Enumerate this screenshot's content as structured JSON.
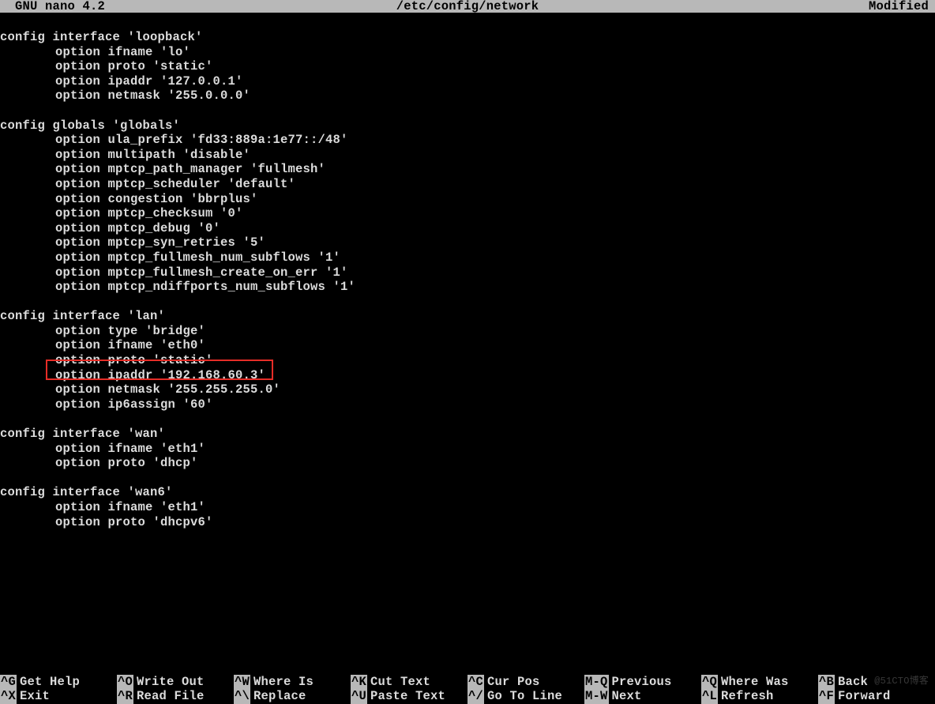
{
  "title_bar": {
    "app": "  GNU nano 4.2",
    "file": "/etc/config/network",
    "status": "Modified"
  },
  "lines": [
    {
      "c": "c0",
      "t": "config interface 'loopback'"
    },
    {
      "c": "c8",
      "t": "option ifname 'lo'"
    },
    {
      "c": "c8",
      "t": "option proto 'static'"
    },
    {
      "c": "c8",
      "t": "option ipaddr '127.0.0.1'"
    },
    {
      "c": "c8",
      "t": "option netmask '255.0.0.0'"
    },
    {
      "c": "c0",
      "t": ""
    },
    {
      "c": "c0",
      "t": "config globals 'globals'"
    },
    {
      "c": "c8",
      "t": "option ula_prefix 'fd33:889a:1e77::/48'"
    },
    {
      "c": "c8",
      "t": "option multipath 'disable'"
    },
    {
      "c": "c8",
      "t": "option mptcp_path_manager 'fullmesh'"
    },
    {
      "c": "c8",
      "t": "option mptcp_scheduler 'default'"
    },
    {
      "c": "c8",
      "t": "option congestion 'bbrplus'"
    },
    {
      "c": "c8",
      "t": "option mptcp_checksum '0'"
    },
    {
      "c": "c8",
      "t": "option mptcp_debug '0'"
    },
    {
      "c": "c8",
      "t": "option mptcp_syn_retries '5'"
    },
    {
      "c": "c8",
      "t": "option mptcp_fullmesh_num_subflows '1'"
    },
    {
      "c": "c8",
      "t": "option mptcp_fullmesh_create_on_err '1'"
    },
    {
      "c": "c8",
      "t": "option mptcp_ndiffports_num_subflows '1'"
    },
    {
      "c": "c0",
      "t": ""
    },
    {
      "c": "c0",
      "t": "config interface 'lan'"
    },
    {
      "c": "c8",
      "t": "option type 'bridge'"
    },
    {
      "c": "c8",
      "t": "option ifname 'eth0'"
    },
    {
      "c": "c8",
      "t": "option proto 'static'"
    },
    {
      "c": "c8",
      "t": "option ipaddr '192.168.60.3'"
    },
    {
      "c": "c8",
      "t": "option netmask '255.255.255.0'"
    },
    {
      "c": "c8",
      "t": "option ip6assign '60'"
    },
    {
      "c": "c0",
      "t": ""
    },
    {
      "c": "c0",
      "t": "config interface 'wan'"
    },
    {
      "c": "c8",
      "t": "option ifname 'eth1'"
    },
    {
      "c": "c8",
      "t": "option proto 'dhcp'"
    },
    {
      "c": "c0",
      "t": ""
    },
    {
      "c": "c0",
      "t": "config interface 'wan6'"
    },
    {
      "c": "c8",
      "t": "option ifname 'eth1'"
    },
    {
      "c": "c8",
      "t": "option proto 'dhcpv6'"
    }
  ],
  "shortcuts": {
    "row0": [
      {
        "key": "^G",
        "label": "Get Help"
      },
      {
        "key": "^O",
        "label": "Write Out"
      },
      {
        "key": "^W",
        "label": "Where Is"
      },
      {
        "key": "^K",
        "label": "Cut Text"
      },
      {
        "key": "^C",
        "label": "Cur Pos"
      },
      {
        "key": "M-Q",
        "label": "Previous"
      },
      {
        "key": "^Q",
        "label": "Where Was"
      },
      {
        "key": "^B",
        "label": "Back"
      }
    ],
    "row1": [
      {
        "key": "^X",
        "label": "Exit"
      },
      {
        "key": "^R",
        "label": "Read File"
      },
      {
        "key": "^\\",
        "label": "Replace"
      },
      {
        "key": "^U",
        "label": "Paste Text"
      },
      {
        "key": "^/",
        "label": "Go To Line"
      },
      {
        "key": "M-W",
        "label": "Next"
      },
      {
        "key": "^L",
        "label": "Refresh"
      },
      {
        "key": "^F",
        "label": "Forward"
      }
    ]
  },
  "watermark": "@51CTO博客"
}
